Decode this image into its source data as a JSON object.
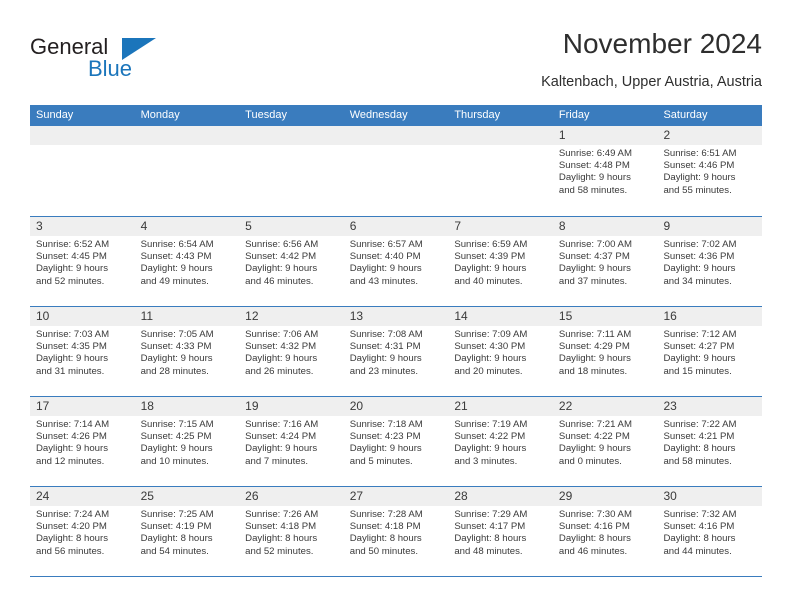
{
  "brand": {
    "name_part1": "General",
    "name_part2": "Blue",
    "triangle_color": "#1b75bb"
  },
  "header": {
    "title": "November 2024",
    "subtitle": "Kaltenbach, Upper Austria, Austria"
  },
  "theme": {
    "header_blue": "#3a7cbe",
    "band_gray": "#efefef",
    "text": "#3a3a3a"
  },
  "weekday_headers": [
    "Sunday",
    "Monday",
    "Tuesday",
    "Wednesday",
    "Thursday",
    "Friday",
    "Saturday"
  ],
  "weeks": [
    [
      {
        "day": "",
        "lines": []
      },
      {
        "day": "",
        "lines": []
      },
      {
        "day": "",
        "lines": []
      },
      {
        "day": "",
        "lines": []
      },
      {
        "day": "",
        "lines": []
      },
      {
        "day": "1",
        "lines": [
          "Sunrise: 6:49 AM",
          "Sunset: 4:48 PM",
          "Daylight: 9 hours",
          "and 58 minutes."
        ]
      },
      {
        "day": "2",
        "lines": [
          "Sunrise: 6:51 AM",
          "Sunset: 4:46 PM",
          "Daylight: 9 hours",
          "and 55 minutes."
        ]
      }
    ],
    [
      {
        "day": "3",
        "lines": [
          "Sunrise: 6:52 AM",
          "Sunset: 4:45 PM",
          "Daylight: 9 hours",
          "and 52 minutes."
        ]
      },
      {
        "day": "4",
        "lines": [
          "Sunrise: 6:54 AM",
          "Sunset: 4:43 PM",
          "Daylight: 9 hours",
          "and 49 minutes."
        ]
      },
      {
        "day": "5",
        "lines": [
          "Sunrise: 6:56 AM",
          "Sunset: 4:42 PM",
          "Daylight: 9 hours",
          "and 46 minutes."
        ]
      },
      {
        "day": "6",
        "lines": [
          "Sunrise: 6:57 AM",
          "Sunset: 4:40 PM",
          "Daylight: 9 hours",
          "and 43 minutes."
        ]
      },
      {
        "day": "7",
        "lines": [
          "Sunrise: 6:59 AM",
          "Sunset: 4:39 PM",
          "Daylight: 9 hours",
          "and 40 minutes."
        ]
      },
      {
        "day": "8",
        "lines": [
          "Sunrise: 7:00 AM",
          "Sunset: 4:37 PM",
          "Daylight: 9 hours",
          "and 37 minutes."
        ]
      },
      {
        "day": "9",
        "lines": [
          "Sunrise: 7:02 AM",
          "Sunset: 4:36 PM",
          "Daylight: 9 hours",
          "and 34 minutes."
        ]
      }
    ],
    [
      {
        "day": "10",
        "lines": [
          "Sunrise: 7:03 AM",
          "Sunset: 4:35 PM",
          "Daylight: 9 hours",
          "and 31 minutes."
        ]
      },
      {
        "day": "11",
        "lines": [
          "Sunrise: 7:05 AM",
          "Sunset: 4:33 PM",
          "Daylight: 9 hours",
          "and 28 minutes."
        ]
      },
      {
        "day": "12",
        "lines": [
          "Sunrise: 7:06 AM",
          "Sunset: 4:32 PM",
          "Daylight: 9 hours",
          "and 26 minutes."
        ]
      },
      {
        "day": "13",
        "lines": [
          "Sunrise: 7:08 AM",
          "Sunset: 4:31 PM",
          "Daylight: 9 hours",
          "and 23 minutes."
        ]
      },
      {
        "day": "14",
        "lines": [
          "Sunrise: 7:09 AM",
          "Sunset: 4:30 PM",
          "Daylight: 9 hours",
          "and 20 minutes."
        ]
      },
      {
        "day": "15",
        "lines": [
          "Sunrise: 7:11 AM",
          "Sunset: 4:29 PM",
          "Daylight: 9 hours",
          "and 18 minutes."
        ]
      },
      {
        "day": "16",
        "lines": [
          "Sunrise: 7:12 AM",
          "Sunset: 4:27 PM",
          "Daylight: 9 hours",
          "and 15 minutes."
        ]
      }
    ],
    [
      {
        "day": "17",
        "lines": [
          "Sunrise: 7:14 AM",
          "Sunset: 4:26 PM",
          "Daylight: 9 hours",
          "and 12 minutes."
        ]
      },
      {
        "day": "18",
        "lines": [
          "Sunrise: 7:15 AM",
          "Sunset: 4:25 PM",
          "Daylight: 9 hours",
          "and 10 minutes."
        ]
      },
      {
        "day": "19",
        "lines": [
          "Sunrise: 7:16 AM",
          "Sunset: 4:24 PM",
          "Daylight: 9 hours",
          "and 7 minutes."
        ]
      },
      {
        "day": "20",
        "lines": [
          "Sunrise: 7:18 AM",
          "Sunset: 4:23 PM",
          "Daylight: 9 hours",
          "and 5 minutes."
        ]
      },
      {
        "day": "21",
        "lines": [
          "Sunrise: 7:19 AM",
          "Sunset: 4:22 PM",
          "Daylight: 9 hours",
          "and 3 minutes."
        ]
      },
      {
        "day": "22",
        "lines": [
          "Sunrise: 7:21 AM",
          "Sunset: 4:22 PM",
          "Daylight: 9 hours",
          "and 0 minutes."
        ]
      },
      {
        "day": "23",
        "lines": [
          "Sunrise: 7:22 AM",
          "Sunset: 4:21 PM",
          "Daylight: 8 hours",
          "and 58 minutes."
        ]
      }
    ],
    [
      {
        "day": "24",
        "lines": [
          "Sunrise: 7:24 AM",
          "Sunset: 4:20 PM",
          "Daylight: 8 hours",
          "and 56 minutes."
        ]
      },
      {
        "day": "25",
        "lines": [
          "Sunrise: 7:25 AM",
          "Sunset: 4:19 PM",
          "Daylight: 8 hours",
          "and 54 minutes."
        ]
      },
      {
        "day": "26",
        "lines": [
          "Sunrise: 7:26 AM",
          "Sunset: 4:18 PM",
          "Daylight: 8 hours",
          "and 52 minutes."
        ]
      },
      {
        "day": "27",
        "lines": [
          "Sunrise: 7:28 AM",
          "Sunset: 4:18 PM",
          "Daylight: 8 hours",
          "and 50 minutes."
        ]
      },
      {
        "day": "28",
        "lines": [
          "Sunrise: 7:29 AM",
          "Sunset: 4:17 PM",
          "Daylight: 8 hours",
          "and 48 minutes."
        ]
      },
      {
        "day": "29",
        "lines": [
          "Sunrise: 7:30 AM",
          "Sunset: 4:16 PM",
          "Daylight: 8 hours",
          "and 46 minutes."
        ]
      },
      {
        "day": "30",
        "lines": [
          "Sunrise: 7:32 AM",
          "Sunset: 4:16 PM",
          "Daylight: 8 hours",
          "and 44 minutes."
        ]
      }
    ]
  ]
}
